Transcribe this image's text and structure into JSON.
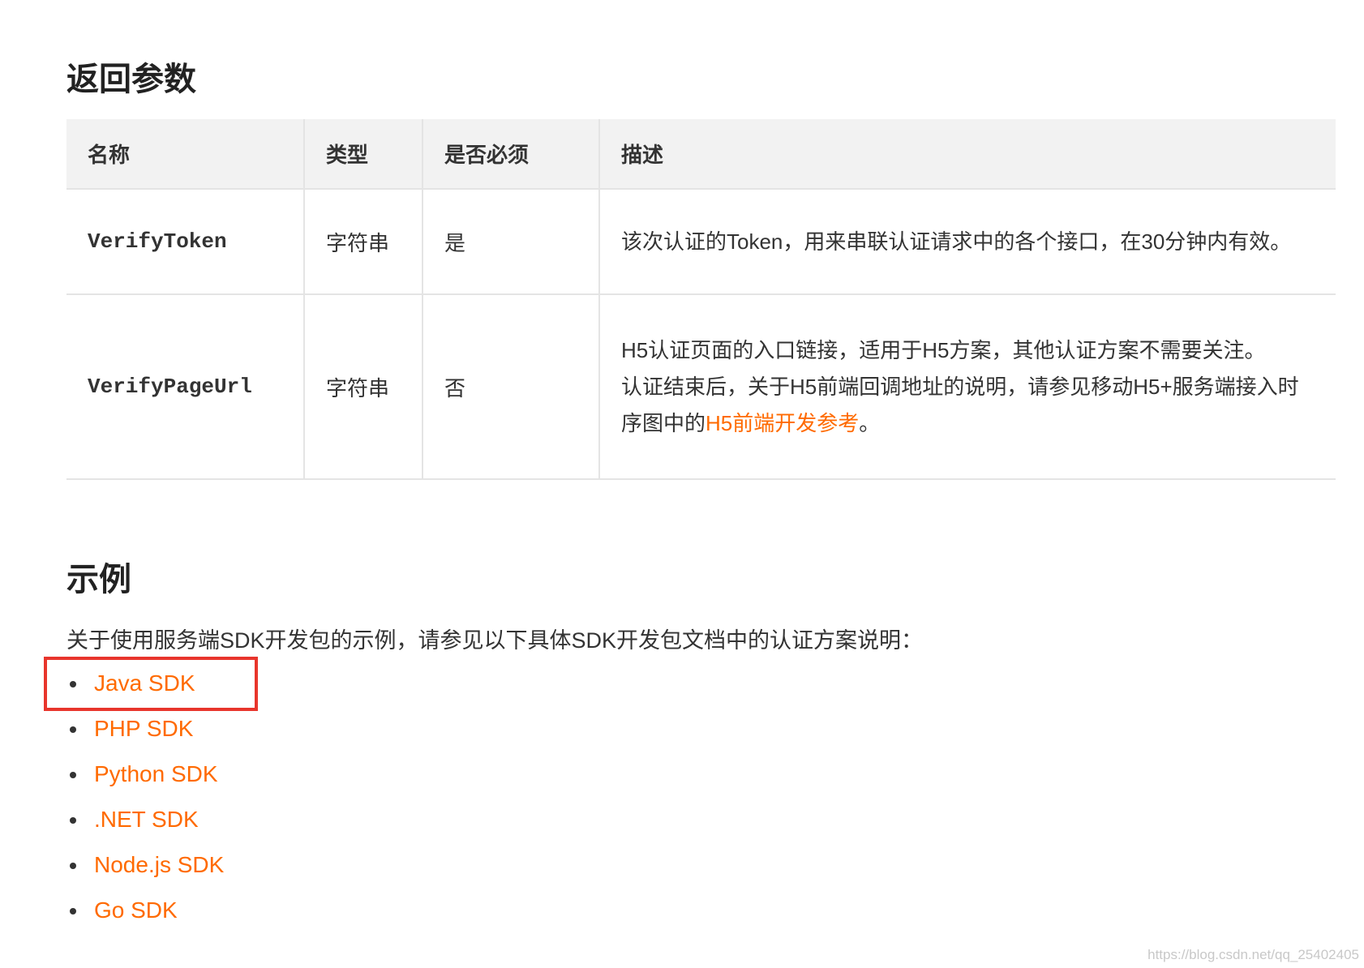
{
  "sections": {
    "return_params_title": "返回参数",
    "example_title": "示例"
  },
  "table": {
    "headers": [
      "名称",
      "类型",
      "是否必须",
      "描述"
    ],
    "rows": [
      {
        "name": "VerifyToken",
        "type": "字符串",
        "required": "是",
        "description": "该次认证的Token，用来串联认证请求中的各个接口，在30分钟内有效。"
      },
      {
        "name": "VerifyPageUrl",
        "type": "字符串",
        "required": "否",
        "description_1": "H5认证页面的入口链接，适用于H5方案，其他认证方案不需要关注。",
        "description_2_prefix": "认证结束后，关于H5前端回调地址的说明，请参见移动H5+服务端接入时序图中的",
        "description_2_link": "H5前端开发参考",
        "description_2_suffix": "。"
      }
    ]
  },
  "example": {
    "intro": "关于使用服务端SDK开发包的示例，请参见以下具体SDK开发包文档中的认证方案说明：",
    "sdk_links": [
      "Java SDK",
      "PHP SDK",
      "Python SDK",
      ".NET SDK",
      "Node.js SDK",
      "Go SDK"
    ]
  },
  "colors": {
    "link": "#ff6a00",
    "highlight_box": "#e8352c",
    "header_bg": "#f2f2f2"
  },
  "watermark": "https://blog.csdn.net/qq_25402405"
}
